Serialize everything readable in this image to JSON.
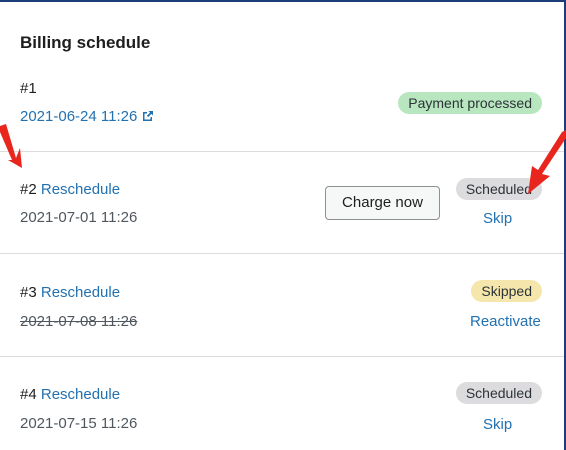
{
  "title": "Billing schedule",
  "rows": [
    {
      "number": "#1",
      "reschedule": "",
      "date": "2021-06-24 11:26",
      "status": "Payment processed",
      "action": ""
    },
    {
      "number": "#2",
      "reschedule": "Reschedule",
      "date": "2021-07-01 11:26",
      "status": "Scheduled",
      "button": "Charge now",
      "action": "Skip"
    },
    {
      "number": "#3",
      "reschedule": "Reschedule",
      "date": "2021-07-08 11:26",
      "status": "Skipped",
      "action": "Reactivate"
    },
    {
      "number": "#4",
      "reschedule": "Reschedule",
      "date": "2021-07-15 11:26",
      "status": "Scheduled",
      "action": "Skip"
    }
  ],
  "colors": {
    "link": "#2271b1",
    "badge_processed": "#b8e6bf",
    "badge_scheduled": "#dcdcde",
    "badge_skipped": "#f5e6ab",
    "annotation_arrow": "#e8261e",
    "border": "#1d3d7a"
  },
  "icons": {
    "external_link": "external-link-icon",
    "annotation": "red-arrow-icon"
  }
}
